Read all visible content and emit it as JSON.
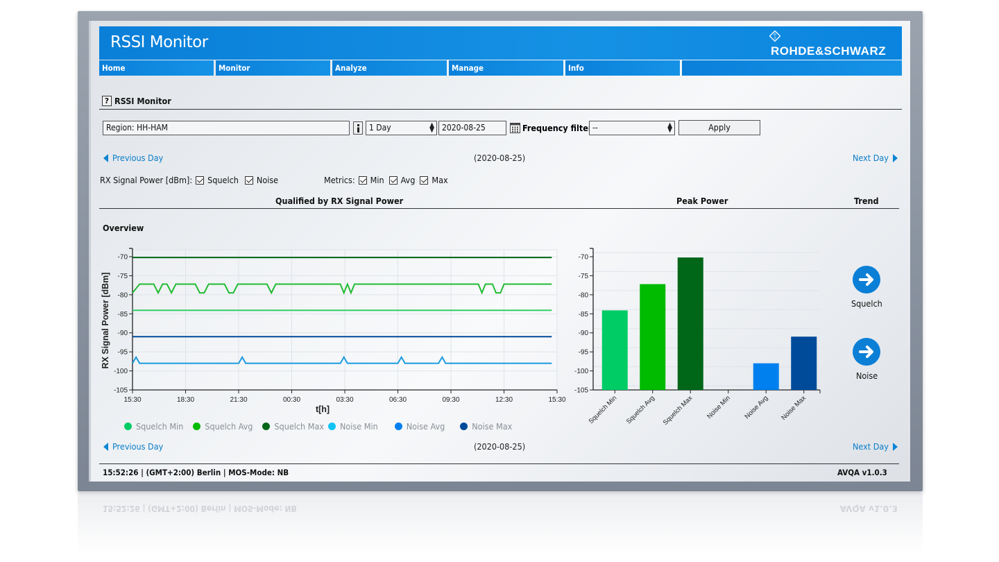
{
  "app": {
    "title": "RSSI Monitor",
    "brand": "ROHDE&SCHWARZ"
  },
  "nav": {
    "items": [
      {
        "label": "Home"
      },
      {
        "label": "Monitor"
      },
      {
        "label": "Analyze"
      },
      {
        "label": "Manage"
      },
      {
        "label": "Info"
      },
      {
        "label": ""
      }
    ]
  },
  "page": {
    "help_label": "?",
    "title": "RSSI Monitor"
  },
  "controls": {
    "region_value": "Region: HH-HAM",
    "period_value": "1 Day",
    "date_value": "2020-08-25",
    "frequency_filter_label": "Frequency filter:",
    "frequency_filter_value": "--",
    "apply_label": "Apply"
  },
  "navigation": {
    "previous_label": "Previous Day",
    "next_label": "Next Day",
    "current_date": "(2020-08-25)"
  },
  "filters": {
    "signal_label": "RX Signal Power [dBm]:",
    "signal_options": [
      {
        "label": "Squelch",
        "checked": true
      },
      {
        "label": "Noise",
        "checked": true
      }
    ],
    "metrics_label": "Metrics:",
    "metrics_options": [
      {
        "label": "Min",
        "checked": true
      },
      {
        "label": "Avg",
        "checked": true
      },
      {
        "label": "Max",
        "checked": true
      }
    ]
  },
  "columns": {
    "qualified": "Qualified by RX Signal Power",
    "peak": "Peak Power",
    "trend": "Trend"
  },
  "overview_label": "Overview",
  "legend": [
    {
      "label": "Squelch Min",
      "color": "#00cc66"
    },
    {
      "label": "Squelch Avg",
      "color": "#00bb00"
    },
    {
      "label": "Squelch Max",
      "color": "#006618"
    },
    {
      "label": "Noise Min",
      "color": "#11c4f4"
    },
    {
      "label": "Noise Avg",
      "color": "#0080ee"
    },
    {
      "label": "Noise Max",
      "color": "#004a9a"
    }
  ],
  "trend": {
    "squelch_label": "Squelch",
    "noise_label": "Noise"
  },
  "footer": {
    "status": "15:52:26 | (GMT+2:00) Berlin  | MOS-Mode: NB",
    "version": "AVQA v1.0.3"
  },
  "chart_data": [
    {
      "type": "line",
      "title": "Overview",
      "xlabel": "t[h]",
      "ylabel": "RX Signal Power [dBm]",
      "ylim": [
        -105,
        -70
      ],
      "yticks": [
        -70,
        -75,
        -80,
        -85,
        -90,
        -95,
        -100,
        -105
      ],
      "xticks_hours": [
        0,
        3,
        6,
        9,
        12,
        15,
        18,
        21,
        24
      ],
      "xtick_labels": [
        "15:30",
        "18:30",
        "21:30",
        "00:30",
        "03:30",
        "06:30",
        "09:30",
        "12:30",
        "15:30"
      ],
      "xlim_hours": [
        0,
        24
      ],
      "grid": true,
      "legend_position": "bottom",
      "series": [
        {
          "name": "Squelch Max",
          "color": "#006618",
          "points": [
            [
              0,
              -70.2
            ],
            [
              23.7,
              -70.2
            ]
          ]
        },
        {
          "name": "Squelch Avg",
          "color": "#22bb33",
          "points": [
            [
              0,
              -79.5
            ],
            [
              0.4,
              -77.2
            ],
            [
              1.2,
              -77.2
            ],
            [
              1.45,
              -79.5
            ],
            [
              1.7,
              -77.2
            ],
            [
              1.95,
              -77.2
            ],
            [
              2.2,
              -79.5
            ],
            [
              2.45,
              -77.2
            ],
            [
              3.55,
              -77.2
            ],
            [
              3.8,
              -79.5
            ],
            [
              4.05,
              -79.5
            ],
            [
              4.3,
              -77.2
            ],
            [
              5.2,
              -77.2
            ],
            [
              5.45,
              -79.5
            ],
            [
              5.7,
              -79.5
            ],
            [
              5.95,
              -77.2
            ],
            [
              7.6,
              -77.2
            ],
            [
              7.85,
              -79.5
            ],
            [
              8.1,
              -77.2
            ],
            [
              11.75,
              -77.2
            ],
            [
              11.95,
              -79.5
            ],
            [
              12.15,
              -77.2
            ],
            [
              12.35,
              -79.5
            ],
            [
              12.55,
              -77.2
            ],
            [
              19.55,
              -77.2
            ],
            [
              19.75,
              -79.5
            ],
            [
              19.95,
              -77.2
            ],
            [
              20.35,
              -77.2
            ],
            [
              20.55,
              -79.5
            ],
            [
              20.8,
              -79.5
            ],
            [
              21.0,
              -77.2
            ],
            [
              23.7,
              -77.2
            ]
          ]
        },
        {
          "name": "Squelch Min",
          "color": "#33cc66",
          "points": [
            [
              0,
              -84.1
            ],
            [
              23.7,
              -84.1
            ]
          ]
        },
        {
          "name": "Noise Max",
          "color": "#004a9a",
          "points": [
            [
              0,
              -91.0
            ],
            [
              23.7,
              -91.0
            ]
          ]
        },
        {
          "name": "Noise Avg",
          "color": "#1a9ae0",
          "points": [
            [
              0,
              -98
            ],
            [
              0.2,
              -96.4
            ],
            [
              0.4,
              -98
            ],
            [
              6.0,
              -98
            ],
            [
              6.2,
              -96.4
            ],
            [
              6.4,
              -98
            ],
            [
              11.75,
              -98
            ],
            [
              11.95,
              -96.4
            ],
            [
              12.15,
              -98
            ],
            [
              15.0,
              -98
            ],
            [
              15.2,
              -96.4
            ],
            [
              15.4,
              -98
            ],
            [
              17.3,
              -98
            ],
            [
              17.5,
              -96.4
            ],
            [
              17.7,
              -98
            ],
            [
              23.7,
              -98
            ]
          ]
        }
      ]
    },
    {
      "type": "bar",
      "title": "Peak Power",
      "ylim": [
        -105,
        -70
      ],
      "yticks": [
        -70,
        -75,
        -80,
        -85,
        -90,
        -95,
        -100,
        -105
      ],
      "categories": [
        "Squelch Min",
        "Squelch Avg",
        "Squelch Max",
        "Noise Min",
        "Noise Avg",
        "Noise Max"
      ],
      "values": [
        -84.1,
        -77.2,
        -70.2,
        null,
        -98.0,
        -91.0
      ],
      "colors": [
        "#00cc66",
        "#00bb00",
        "#006618",
        "#11c4f4",
        "#0080ee",
        "#004a9a"
      ],
      "grid": true
    }
  ]
}
